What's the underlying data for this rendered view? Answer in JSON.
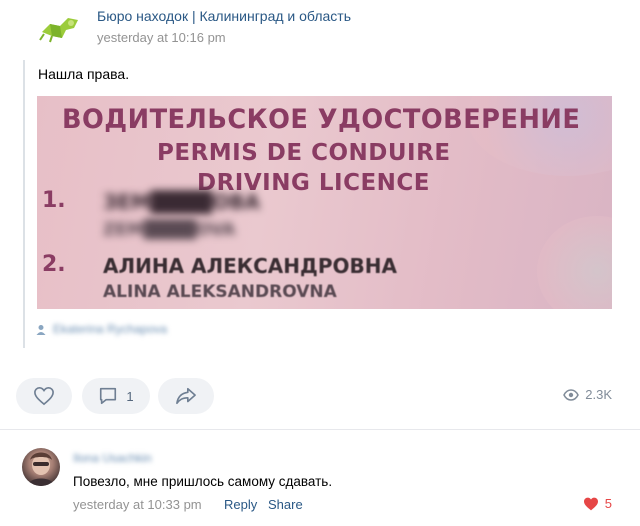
{
  "post": {
    "group_name": "Бюро находок | Калининград и область",
    "time": "yesterday at 10:16 pm",
    "text": "Нашла права.",
    "photo": {
      "title_ru": "ВОДИТЕЛЬСКОЕ УДОСТОВЕРЕНИЕ",
      "title_fr": "PERMIS DE CONDUIRE",
      "title_en": "DRIVING LICENCE",
      "field1_num": "1.",
      "field2_num": "2.",
      "field1_line1": "ЗЕМ████ОВА",
      "field1_line2": "ZEM████OVA",
      "field2_line1": "АЛИНА АЛЕКСАНДРОВНА",
      "field2_line2": "ALINA ALEKSANDROVNA"
    },
    "author_name": "Ekaterina Rychapova"
  },
  "actions": {
    "comment_count": "1",
    "views": "2.3K"
  },
  "comment": {
    "author": "Ilona Usachkin",
    "text": "Повезло, мне пришлось самому сдавать.",
    "time": "yesterday at 10:33 pm",
    "reply_label": "Reply",
    "share_label": "Share",
    "likes": "5"
  },
  "colors": {
    "link": "#2a5885",
    "muted": "#939393",
    "like": "#e64646",
    "pill": "#f0f2f5"
  }
}
